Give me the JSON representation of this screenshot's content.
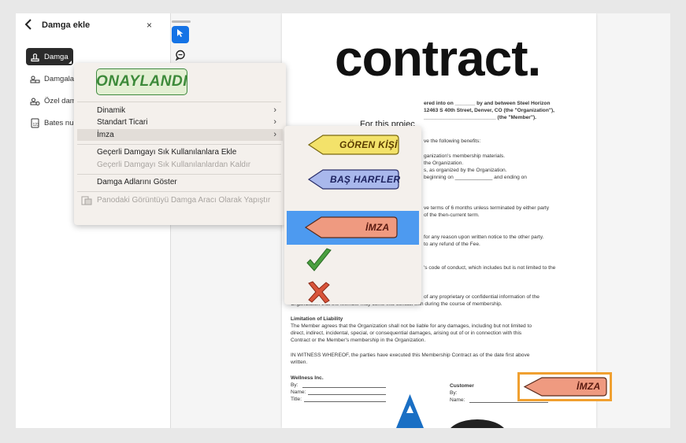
{
  "panel": {
    "title": "Damga ekle",
    "back_icon": "chevron-left-icon",
    "close_label": "×",
    "items": [
      {
        "label": "Damga",
        "icon": "stamp-icon",
        "active": true
      },
      {
        "label": "Damgalar",
        "icon": "stamps-icon",
        "active": false
      },
      {
        "label": "Özel damg",
        "icon": "custom-stamp-icon",
        "active": false
      },
      {
        "label": "Bates num",
        "icon": "bates-number-icon",
        "active": false
      }
    ]
  },
  "toolbar": {
    "select_tool_icon": "pointer-icon",
    "comment_tool_icon": "comment-icon"
  },
  "context_menu": {
    "stamp_preview": "ONAYLANDI",
    "items": [
      {
        "label": "Dinamik",
        "submenu": true,
        "highlighted": false,
        "disabled": false
      },
      {
        "label": "Standart Ticari",
        "submenu": true,
        "highlighted": false,
        "disabled": false
      },
      {
        "label": "İmza",
        "submenu": true,
        "highlighted": true,
        "disabled": false
      },
      {
        "label": "Geçerli Damgayı Sık Kullanılanlara Ekle",
        "submenu": false,
        "highlighted": false,
        "disabled": false
      },
      {
        "label": "Geçerli Damgayı Sık Kullanılanlardan Kaldır",
        "submenu": false,
        "highlighted": false,
        "disabled": true
      },
      {
        "label": "Damga Adlarını Göster",
        "submenu": false,
        "highlighted": false,
        "disabled": false
      },
      {
        "label": "Panodaki Görüntüyü Damga Aracı Olarak Yapıştır",
        "submenu": false,
        "highlighted": false,
        "disabled": true
      }
    ]
  },
  "submenu": {
    "items": [
      {
        "label": "GÖREN KİŞİ",
        "type": "arrow-stamp",
        "color": "#f3e26a",
        "text_color": "#6b4b00"
      },
      {
        "label": "BAŞ HARFLER",
        "type": "arrow-stamp",
        "color": "#a9b8ec",
        "text_color": "#2a2f6b"
      },
      {
        "label": "İMZA",
        "type": "arrow-stamp",
        "color": "#ef9a80",
        "text_color": "#6b1a10",
        "selected": true
      },
      {
        "label": "",
        "type": "checkmark-icon",
        "color": "#3f9a3a"
      },
      {
        "label": "",
        "type": "x-mark-icon",
        "color": "#d9543a"
      }
    ]
  },
  "document": {
    "logo": "contract.",
    "intro_line1": "ered into on _______ by and between Steel Horizon",
    "intro_line2": "12463 S 40th Street, Denver, CO (the \"Organization\"),",
    "intro_line3": "_________________________ (the \"Member\").",
    "purpose_partial": "For this projec",
    "benefits_line": "ve the following benefits:",
    "benefit1": "ganization's membership materials.",
    "benefit2": "the Organization.",
    "benefit3": "s, as organized by the Organization.",
    "benefit4": "beginning on _____________ and ending on",
    "term1": "ve terms of 6 months unless terminated by either party",
    "term2": "of the then-current term.",
    "term3": "for any reason upon written notice to the other party.",
    "term4": "to any refund of the Fee.",
    "conduct": "'s code of conduct, which includes but is not limited to the",
    "conf1": "of any proprietary or confidential information of the",
    "conf2": "Organization that the Member may come into contact with during the course of membership.",
    "liability_heading": "Limitation of Liability",
    "liability1": "The Member agrees that the Organization shall not be liable for any damages, including but not limited to",
    "liability2": "direct, indirect, incidental, special, or consequential damages, arising out of or in connection with this",
    "liability3": "Contract or the Member's membership in the Organization.",
    "witness1": "IN WITNESS WHEREOF, the parties have executed this Membership Contract as of the date first above",
    "witness2": "written.",
    "sig_left_title": "Wellness Inc.",
    "sig_left_by": "By:",
    "sig_left_name": "Name:",
    "sig_left_titlefield": "Title:",
    "sig_right_title": "Customer",
    "sig_right_by": "By:",
    "sig_right_name": "Name:",
    "placed_stamp": "İMZA"
  }
}
